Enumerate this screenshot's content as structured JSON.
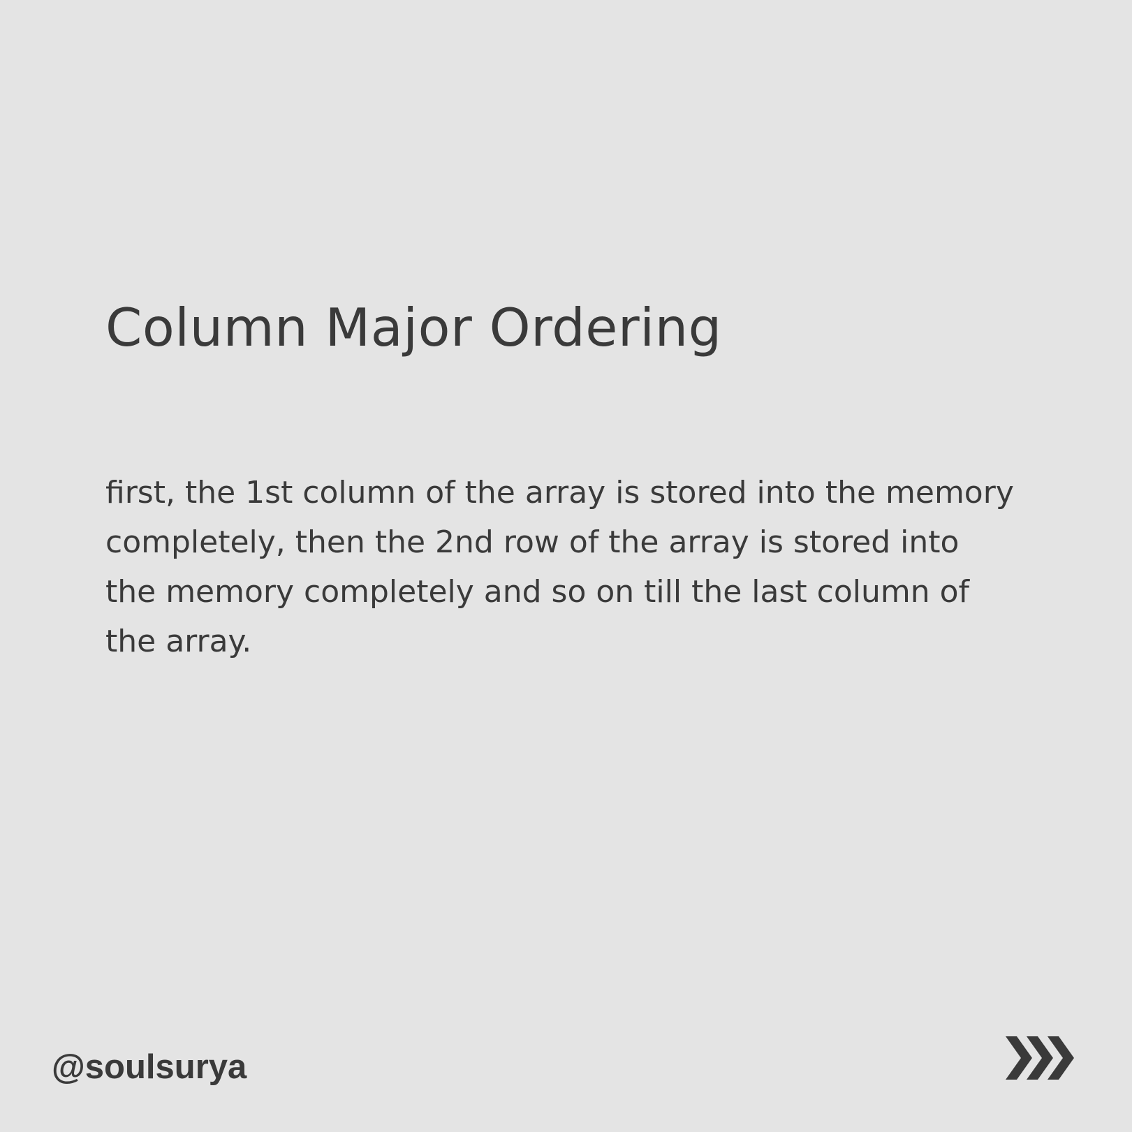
{
  "slide": {
    "title": "Column Major Ordering",
    "body_lines": [
      "first, the 1st column of the array is stored into the memory",
      "completely, then the 2nd row of the array is stored into",
      "the memory completely and so on till the last column of",
      "the array."
    ],
    "handle": "@soulsurya",
    "next_icon": "triple-chevron-right-icon"
  },
  "colors": {
    "background": "#e4e4e4",
    "text": "#3a3a3a"
  }
}
